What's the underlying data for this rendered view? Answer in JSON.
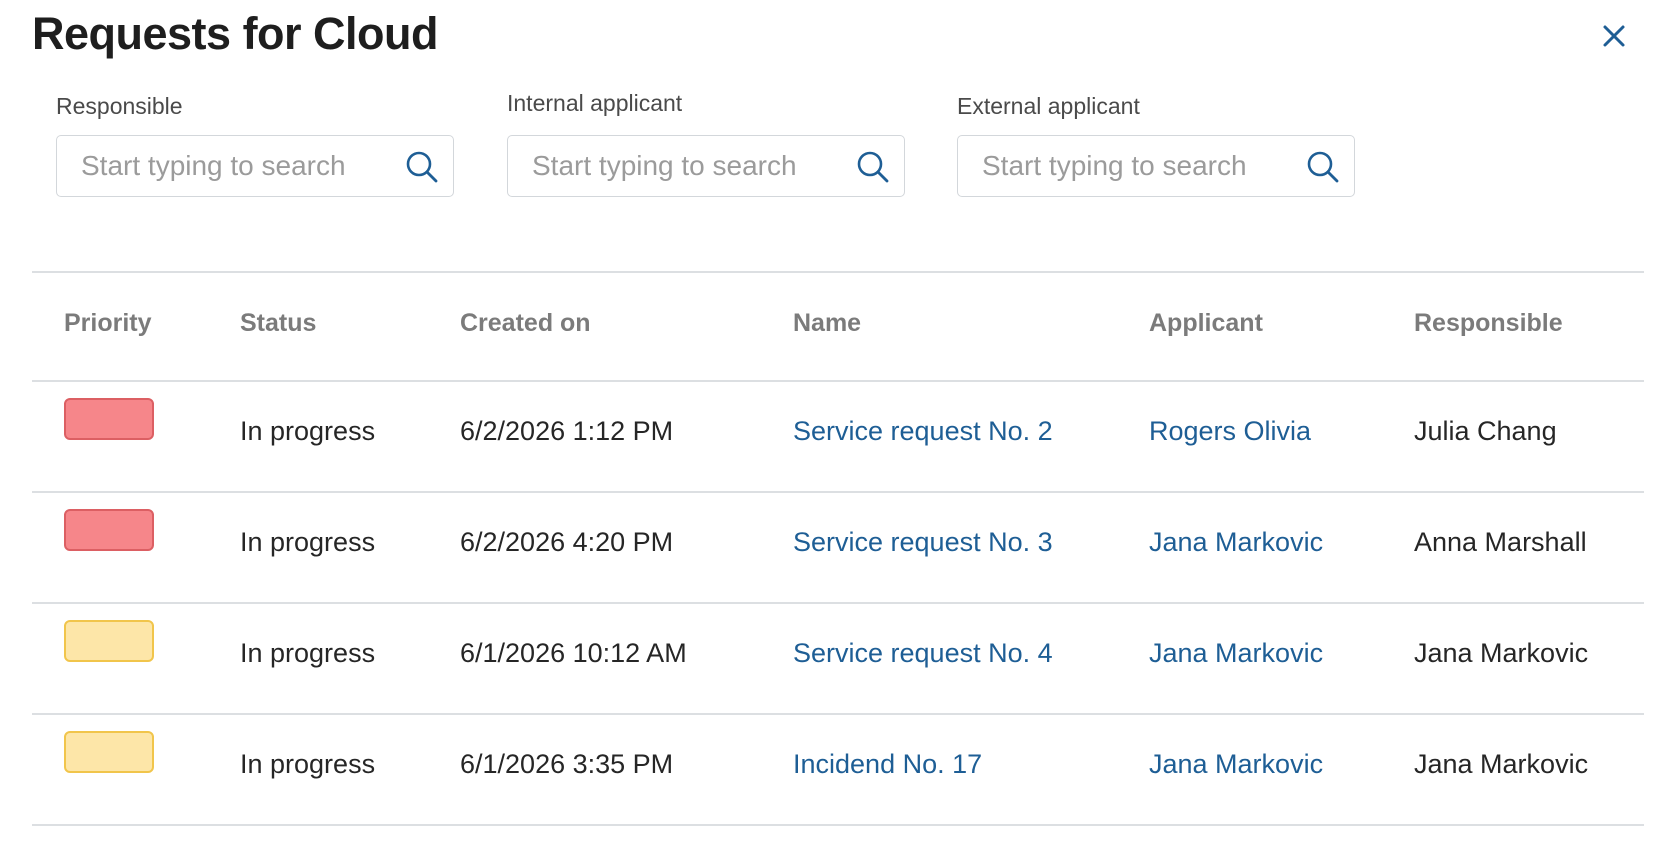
{
  "dialog": {
    "title": "Requests for Cloud",
    "close_icon": "close-icon"
  },
  "filters": [
    {
      "label": "Responsible",
      "placeholder": "Start typing to search",
      "value": "",
      "icon": "search-icon"
    },
    {
      "label": "Internal applicant",
      "placeholder": "Start typing to search",
      "value": "",
      "icon": "search-icon"
    },
    {
      "label": "External applicant",
      "placeholder": "Start typing to search",
      "value": "",
      "icon": "search-icon"
    }
  ],
  "table": {
    "columns": [
      "Priority",
      "Status",
      "Created on",
      "Name",
      "Applicant",
      "Responsible"
    ],
    "rows": [
      {
        "priority": "high",
        "status": "In progress",
        "created_on": "6/2/2026 1:12 PM",
        "name": "Service request No. 2",
        "applicant": "Rogers Olivia",
        "responsible": "Julia Chang"
      },
      {
        "priority": "high",
        "status": "In progress",
        "created_on": "6/2/2026 4:20 PM",
        "name": "Service request No. 3",
        "applicant": "Jana Markovic",
        "responsible": "Anna Marshall"
      },
      {
        "priority": "medium",
        "status": "In progress",
        "created_on": "6/1/2026 10:12 AM",
        "name": "Service request No. 4",
        "applicant": "Jana Markovic",
        "responsible": "Jana Markovic"
      },
      {
        "priority": "medium",
        "status": "In progress",
        "created_on": "6/1/2026 3:35 PM",
        "name": "Incidend No. 17",
        "applicant": "Jana Markovic",
        "responsible": "Jana Markovic"
      }
    ]
  },
  "colors": {
    "priority_high_fill": "#f6868a",
    "priority_medium_fill": "#fde6a8",
    "link": "#1e5e95",
    "accent": "#1e5e95"
  }
}
